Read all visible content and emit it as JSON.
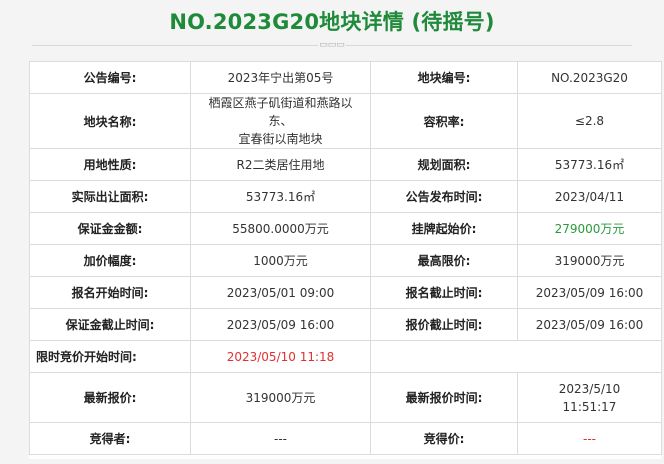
{
  "page": {
    "title": "NO.2023G20地块详情 (待摇号)"
  },
  "divider": {
    "mark": "▭▭▭"
  },
  "rows": [
    {
      "l1": "公告编号:",
      "v1": "2023年宁出第05号",
      "l2": "地块编号:",
      "v2": "NO.2023G20"
    },
    {
      "l1": "地块名称:",
      "v1a": "栖霞区燕子矶街道和燕路以东、",
      "v1b": "宜春街以南地块",
      "l2": "容积率:",
      "v2": "≤2.8"
    },
    {
      "l1": "用地性质:",
      "v1": "R2二类居住用地",
      "l2": "规划面积:",
      "v2": "53773.16㎡"
    },
    {
      "l1": "实际出让面积:",
      "v1": "53773.16㎡",
      "l2": "公告发布时间:",
      "v2": "2023/04/11"
    },
    {
      "l1": "保证金金额:",
      "v1": "55800.0000万元",
      "l2": "挂牌起始价:",
      "v2": "279000万元"
    },
    {
      "l1": "加价幅度:",
      "v1": "1000万元",
      "l2": "最高限价:",
      "v2": "319000万元"
    },
    {
      "l1": "报名开始时间:",
      "v1": "2023/05/01 09:00",
      "l2": "报名截止时间:",
      "v2": "2023/05/09 16:00"
    },
    {
      "l1": "保证金截止时间:",
      "v1": "2023/05/09 16:00",
      "l2": "报价截止时间:",
      "v2": "2023/05/09 16:00"
    },
    {
      "l1": "限时竞价开始时间:",
      "v1": "2023/05/10 11:18"
    },
    {
      "l1": "最新报价:",
      "v1": "319000万元",
      "l2": "最新报价时间:",
      "v2a": "2023/5/10",
      "v2b": "11:51:17"
    },
    {
      "l1": "竞得者:",
      "v1": "---",
      "l2": "竞得价:",
      "v2": "---"
    }
  ],
  "colors": {
    "title": "#1e8a3a",
    "start_price": "#2a9a3a",
    "bid_start_time": "#e03030",
    "win_price": "#e03030"
  }
}
